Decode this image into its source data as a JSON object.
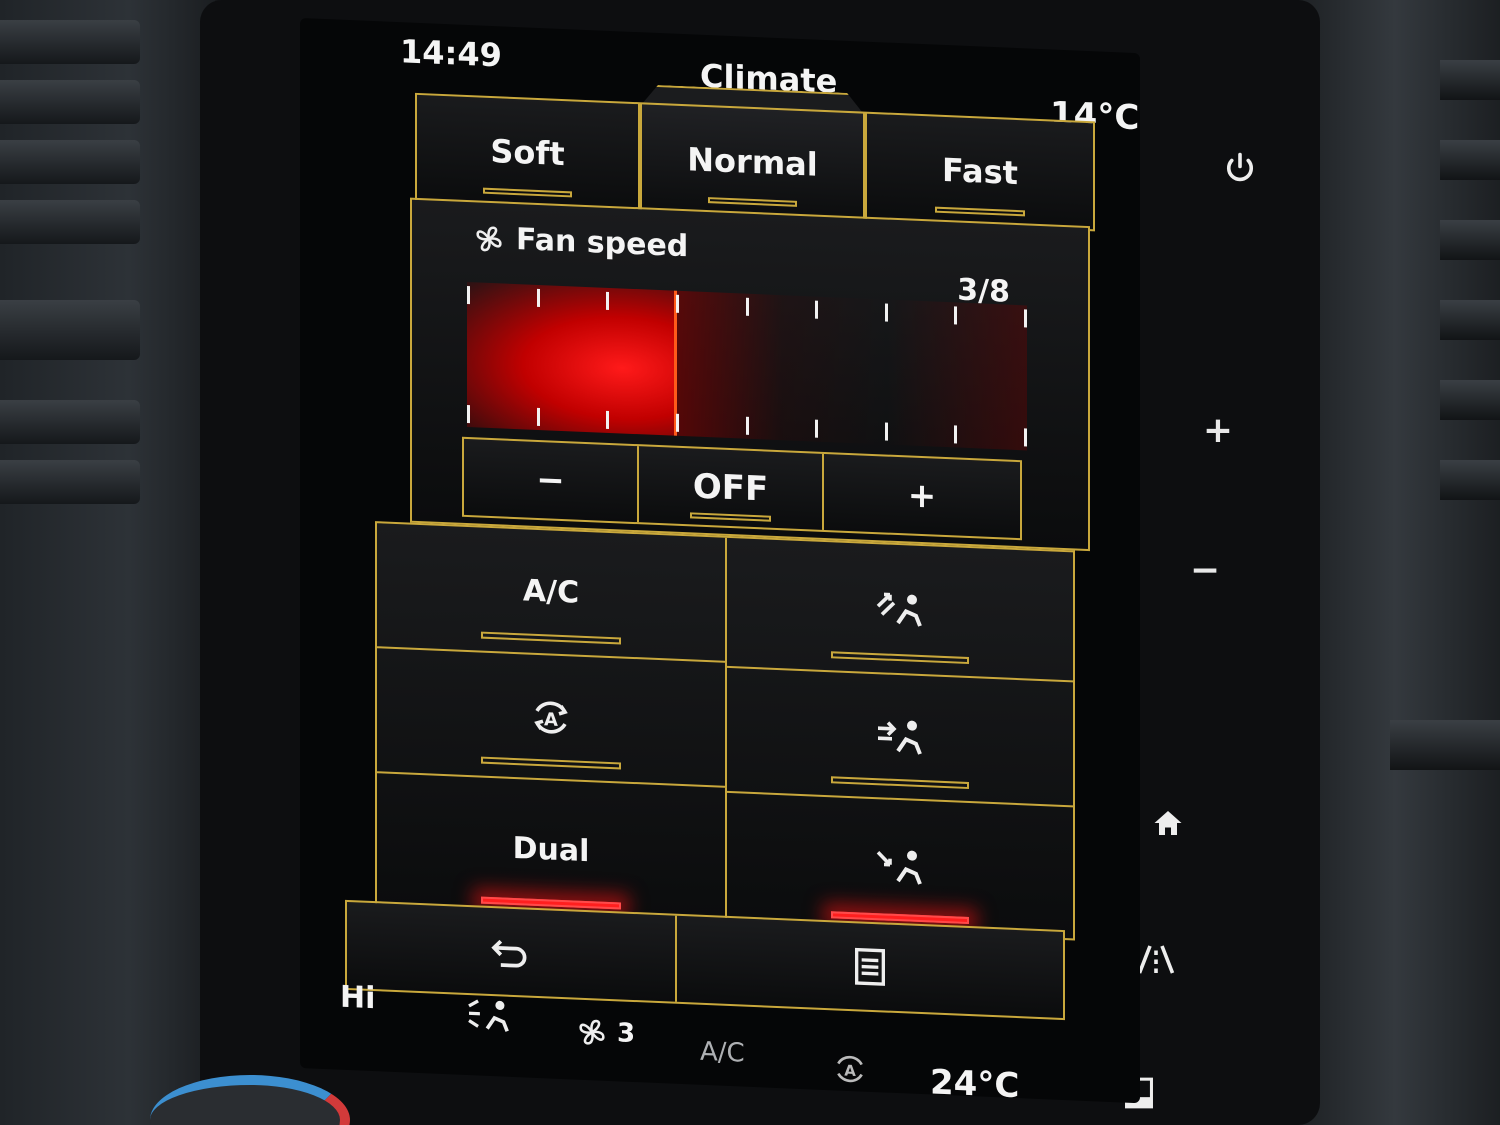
{
  "status": {
    "time": "14:49",
    "title": "Climate",
    "outside_temp": "14°C"
  },
  "modes": [
    {
      "label": "Soft"
    },
    {
      "label": "Normal"
    },
    {
      "label": "Fast"
    }
  ],
  "fan": {
    "label": "Fan speed",
    "value_text": "3/8",
    "level": 3,
    "max": 8,
    "minus": "−",
    "off": "OFF",
    "plus": "+"
  },
  "grid": {
    "ac_label": "A/C",
    "dual_label": "Dual",
    "recirc_icon": "auto-recirculation-icon",
    "vent_icons": [
      "airflow-windscreen-icon",
      "airflow-face-icon",
      "airflow-feet-icon"
    ]
  },
  "bottom": {
    "hi": "Hi",
    "fan_level": "3",
    "ac": "A/C",
    "set_temp": "24°C"
  },
  "hardware": {
    "plus": "+",
    "minus": "−"
  },
  "colors": {
    "gold": "#c9a83c",
    "active_red": "#ff1f1f"
  }
}
